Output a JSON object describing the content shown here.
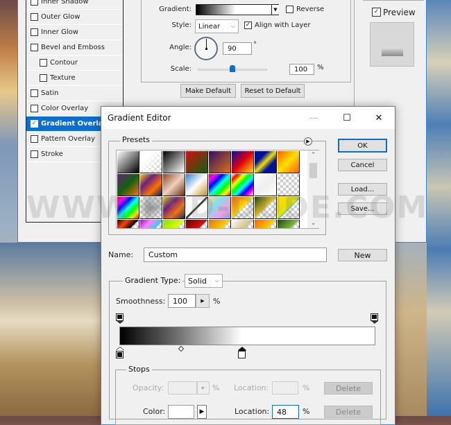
{
  "layer_style": {
    "styles": [
      {
        "label": "Inner Shadow",
        "checked": false,
        "sub": false,
        "selected": false
      },
      {
        "label": "Outer Glow",
        "checked": false,
        "sub": false,
        "selected": false
      },
      {
        "label": "Inner Glow",
        "checked": false,
        "sub": false,
        "selected": false
      },
      {
        "label": "Bevel and Emboss",
        "checked": false,
        "sub": false,
        "selected": false
      },
      {
        "label": "Contour",
        "checked": false,
        "sub": true,
        "selected": false
      },
      {
        "label": "Texture",
        "checked": false,
        "sub": true,
        "selected": false
      },
      {
        "label": "Satin",
        "checked": false,
        "sub": false,
        "selected": false
      },
      {
        "label": "Color Overlay",
        "checked": false,
        "sub": false,
        "selected": false
      },
      {
        "label": "Gradient Overlay",
        "checked": true,
        "sub": false,
        "selected": true
      },
      {
        "label": "Pattern Overlay",
        "checked": false,
        "sub": false,
        "selected": false
      },
      {
        "label": "Stroke",
        "checked": false,
        "sub": false,
        "selected": false
      }
    ],
    "gradient_label": "Gradient:",
    "reverse_label": "Reverse",
    "style_label": "Style:",
    "style_value": "Linear",
    "align_label": "Align with Layer",
    "angle_label": "Angle:",
    "angle_value": "90",
    "angle_unit": "°",
    "scale_label": "Scale:",
    "scale_value": "100",
    "scale_unit": "%",
    "scale_fraction": 0.5,
    "make_default": "Make Default",
    "reset_default": "Reset to Default",
    "preview_label": "Preview"
  },
  "gradient_editor": {
    "title": "Gradient Editor",
    "presets_label": "Presets",
    "ok": "OK",
    "cancel": "Cancel",
    "load": "Load...",
    "save": "Save...",
    "name_label": "Name:",
    "name_value": "Custom",
    "new": "New",
    "gradient_type_label": "Gradient Type:",
    "gradient_type_value": "Solid",
    "smoothness_label": "Smoothness:",
    "smoothness_value": "100",
    "smoothness_unit": "%",
    "stops_label": "Stops",
    "opacity_label": "Opacity:",
    "opacity_unit": "%",
    "location_label": "Location:",
    "location_unit": "%",
    "delete": "Delete",
    "color_label": "Color:",
    "color_location_value": "48",
    "color_stops": [
      0,
      48
    ],
    "opacity_stops": [
      0,
      100
    ],
    "midpoint": 24
  },
  "watermark": "WWW.PSD-DUDE.COM"
}
